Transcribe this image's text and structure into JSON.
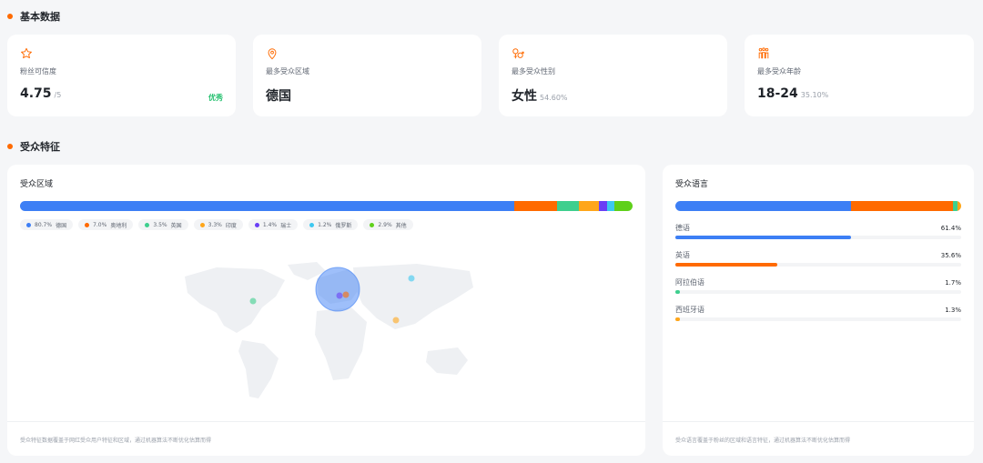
{
  "sections": {
    "basic": "基本数据",
    "audience": "受众特征"
  },
  "stats": [
    {
      "icon": "star-icon",
      "label": "粉丝可信度",
      "value": "4.75",
      "unit": "/5",
      "badge": "优秀"
    },
    {
      "icon": "map-pin-icon",
      "label": "最多受众区域",
      "value": "德国",
      "unit": "",
      "badge": ""
    },
    {
      "icon": "gender-icon",
      "label": "最多受众性别",
      "value": "女性",
      "unit": "54.60%",
      "badge": ""
    },
    {
      "icon": "people-icon",
      "label": "最多受众年龄",
      "value": "18-24",
      "unit": "35.10%",
      "badge": ""
    }
  ],
  "region": {
    "title": "受众区域",
    "items": [
      {
        "name": "德国",
        "pct": "80.7%",
        "value": 80.7,
        "color": "#3d7ff5"
      },
      {
        "name": "奥地利",
        "pct": "7.0%",
        "value": 7.0,
        "color": "#ff6a00"
      },
      {
        "name": "英国",
        "pct": "3.5%",
        "value": 3.5,
        "color": "#3ecf8e"
      },
      {
        "name": "印度",
        "pct": "3.3%",
        "value": 3.3,
        "color": "#ffa61a"
      },
      {
        "name": "瑞士",
        "pct": "1.4%",
        "value": 1.4,
        "color": "#6a3ff5"
      },
      {
        "name": "俄罗斯",
        "pct": "1.2%",
        "value": 1.2,
        "color": "#3cc8f0"
      },
      {
        "name": "其他",
        "pct": "2.9%",
        "value": 2.9,
        "color": "#5fd01a"
      }
    ],
    "footnote": "受众特征数据覆盖于网红受众用户特征和区域，通过机器算法不断优化估算而得"
  },
  "language": {
    "title": "受众语言",
    "items": [
      {
        "name": "德语",
        "pct": "61.4%",
        "value": 61.4,
        "color": "#3d7ff5"
      },
      {
        "name": "英语",
        "pct": "35.6%",
        "value": 35.6,
        "color": "#ff6a00"
      },
      {
        "name": "阿拉伯语",
        "pct": "1.7%",
        "value": 1.7,
        "color": "#3ecf8e"
      },
      {
        "name": "西班牙语",
        "pct": "1.3%",
        "value": 1.3,
        "color": "#ffa61a"
      }
    ],
    "footnote": "受众语言覆盖于粉丝的区域和语言特征，通过机器算法不断优化估算而得"
  }
}
